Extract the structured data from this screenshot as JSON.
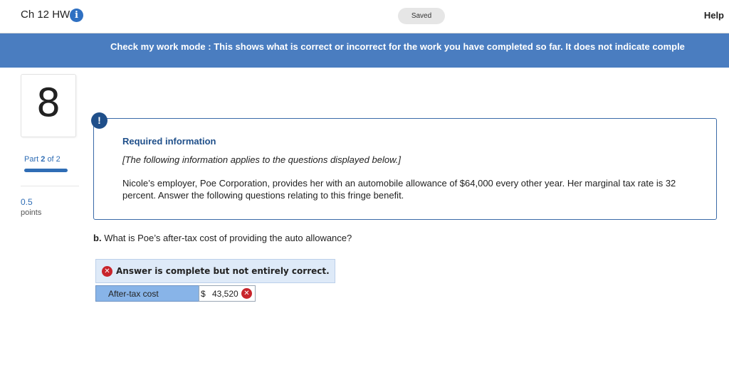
{
  "header": {
    "title": "Ch 12 HW",
    "info_icon": "i",
    "saved_label": "Saved",
    "help_label": "Help"
  },
  "banner": {
    "text": "Check my work mode : This shows what is correct or incorrect for the work you have completed so far. It does not indicate comple"
  },
  "sidebar": {
    "question_number": "8",
    "part_prefix": "Part",
    "part_current": "2",
    "part_suffix": "of 2",
    "points_value": "0.5",
    "points_label": "points"
  },
  "required_info": {
    "alert_icon": "!",
    "title": "Required information",
    "note": "[The following information applies to the questions displayed below.]",
    "body": "Nicole’s employer, Poe Corporation, provides her with an automobile allowance of $64,000 every other year. Her marginal tax rate is 32 percent. Answer the following questions relating to this fringe benefit."
  },
  "question": {
    "label": "b.",
    "text": "What is Poe’s after-tax cost of providing the auto allowance?"
  },
  "feedback": {
    "icon": "✕",
    "message": "Answer is complete but not entirely correct."
  },
  "answer": {
    "label": "After-tax cost",
    "currency": "$",
    "value": "43,520",
    "status_icon": "✕"
  },
  "colors": {
    "banner": "#4a7dc0",
    "accent": "#2f6db5",
    "error": "#c8242b",
    "feedback_bg": "#deeaf8",
    "answer_label_bg": "#88b4e8"
  }
}
